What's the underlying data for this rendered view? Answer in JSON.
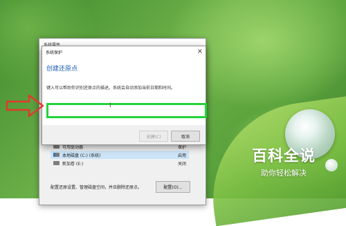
{
  "back_window": {
    "title": "系统属性",
    "protection_rows": [
      {
        "icon": "drive-icon",
        "name": "可用驱动器",
        "status": "保护"
      },
      {
        "icon": "system-drive-icon",
        "name": "本地磁盘 (C:) (系统)",
        "status": "启用"
      },
      {
        "icon": "drive-icon",
        "name": "新加卷 (E:)",
        "status": "关闭"
      }
    ],
    "footer_note": "配置还原设置、管理磁盘空间，并且删除还原点。",
    "configure_button": "配置(O)..."
  },
  "dialog": {
    "title": "系统保护",
    "heading": "创建还原点",
    "description": "键入可以帮助你识别还原点的描述。系统会自动添加当前日期和时间。",
    "input_value": "",
    "create_button": "创建(C)",
    "cancel_button": "取消",
    "close_label": "×"
  },
  "watermark": {
    "title": "百科全说",
    "subtitle": "助你轻松解决"
  },
  "colors": {
    "heading_blue": "#1b5fb4",
    "highlight_green": "#22d43a",
    "arrow_red": "#e03a2e"
  }
}
